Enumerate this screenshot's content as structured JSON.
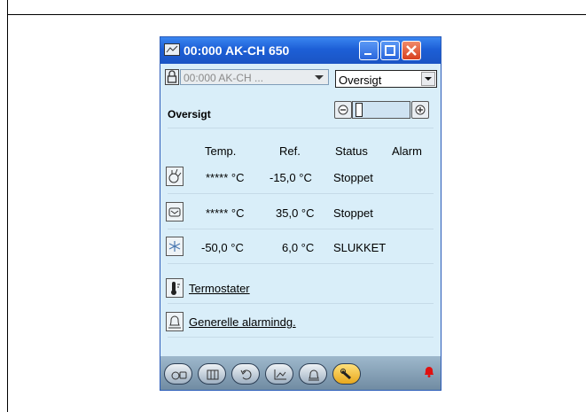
{
  "window": {
    "title": "00:000 AK-CH 650",
    "device_selector": "00:000 AK-CH ...",
    "view_selector": "Oversigt"
  },
  "section": {
    "heading": "Oversigt"
  },
  "table": {
    "columns": [
      "Temp.",
      "Ref.",
      "Status",
      "Alarm"
    ],
    "rows": [
      {
        "icon": "compressor-icon",
        "temp": "***** °C",
        "ref": "-15,0 °C",
        "status": "Stoppet",
        "alarm": ""
      },
      {
        "icon": "condenser-icon",
        "temp": "***** °C",
        "ref": "35,0 °C",
        "status": "Stoppet",
        "alarm": ""
      },
      {
        "icon": "snowflake-icon",
        "temp": "-50,0 °C",
        "ref": "6,0 °C",
        "status": "SLUKKET",
        "alarm": ""
      }
    ]
  },
  "links": {
    "termostater": "Termostater",
    "alarms": "Generelle alarmindg."
  },
  "bottom_nav": [
    "overview",
    "grid",
    "back",
    "chart",
    "alarm",
    "wrench"
  ],
  "colors": {
    "title_blue": "#1d5fd6",
    "panel_bg": "#d9eef9",
    "active_tab": "#f0b63a",
    "alarm_red": "#e01010"
  }
}
